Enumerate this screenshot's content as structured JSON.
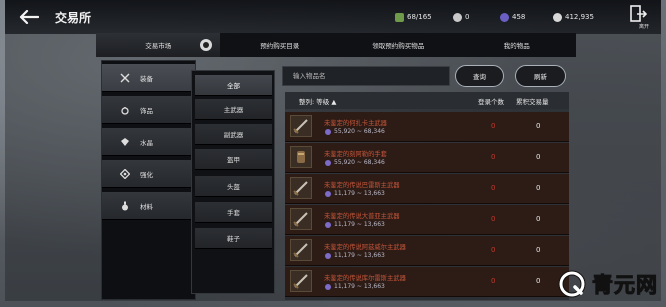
{
  "header": {
    "title": "交易所",
    "resources": [
      {
        "icon": "bag-icon",
        "value": "68/165",
        "color": "#6f9a4a"
      },
      {
        "icon": "silver-coin-icon",
        "value": "0",
        "color": "#c9c9c9"
      },
      {
        "icon": "purple-gem-icon",
        "value": "458",
        "color": "#6b5fc4"
      },
      {
        "icon": "silver-currency-icon",
        "value": "412,935",
        "color": "#d8d8d8"
      }
    ],
    "exit_label": "离开"
  },
  "tabs": [
    {
      "label": "交易市场",
      "active": true
    },
    {
      "label": "预约购买目录",
      "active": false
    },
    {
      "label": "领取预约购买物品",
      "active": false
    },
    {
      "label": "我的物品",
      "active": false
    }
  ],
  "categories": [
    {
      "label": "装备",
      "icon": "crossed-swords-icon",
      "active": true
    },
    {
      "label": "饰品",
      "icon": "ring-icon",
      "active": false
    },
    {
      "label": "水晶",
      "icon": "crystal-icon",
      "active": false
    },
    {
      "label": "强化",
      "icon": "enhance-diamond-icon",
      "active": false
    },
    {
      "label": "材料",
      "icon": "potion-icon",
      "active": false
    }
  ],
  "subcategories": [
    {
      "label": "全部",
      "active": true
    },
    {
      "label": "主武器",
      "active": false
    },
    {
      "label": "副武器",
      "active": false
    },
    {
      "label": "盔甲",
      "active": false
    },
    {
      "label": "头盔",
      "active": false
    },
    {
      "label": "手套",
      "active": false
    },
    {
      "label": "鞋子",
      "active": false
    }
  ],
  "search": {
    "placeholder": "输入物品名",
    "search_label": "查询",
    "refresh_label": "刷新"
  },
  "list": {
    "sort_label": "整列: 等级 ▲",
    "col_listed": "登录个数",
    "col_traded": "累积交易量",
    "rows": [
      {
        "name": "未鉴定的何扎卡主武器",
        "price": "55,920 ~ 68,346",
        "listed": "0",
        "traded": "0"
      },
      {
        "name": "未鉴定的刻阿勒的手套",
        "price": "55,920 ~ 68,346",
        "listed": "0",
        "traded": "0"
      },
      {
        "name": "未鉴定的传说巴雷斯主武器",
        "price": "11,179 ~ 13,663",
        "listed": "0",
        "traded": "0"
      },
      {
        "name": "未鉴定的传说大普亚主武器",
        "price": "11,179 ~ 13,663",
        "listed": "0",
        "traded": "0"
      },
      {
        "name": "未鉴定的传说阿兹威尔主武器",
        "price": "11,179 ~ 13,663",
        "listed": "0",
        "traded": "0"
      },
      {
        "name": "未鉴定的传说库尔雷斯主武器",
        "price": "11,179 ~ 13,663",
        "listed": "0",
        "traded": "0"
      }
    ]
  },
  "watermark": {
    "text": "青元网"
  }
}
